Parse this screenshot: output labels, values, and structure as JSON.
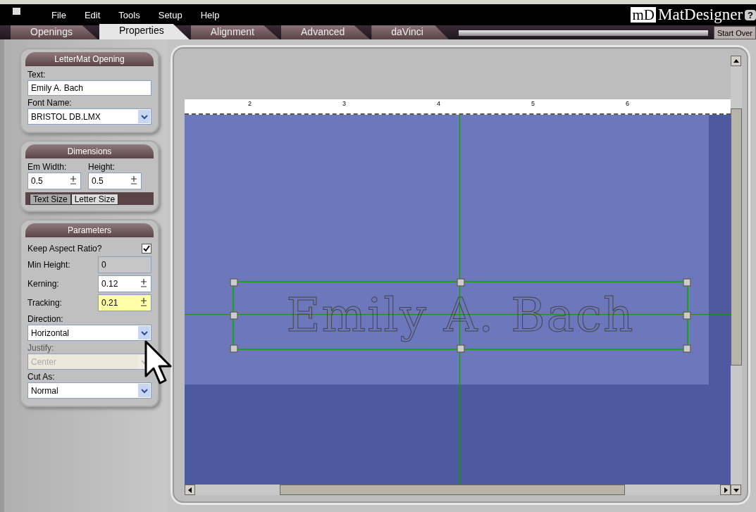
{
  "menu": [
    "File",
    "Edit",
    "Tools",
    "Setup",
    "Help"
  ],
  "brand": {
    "badge": "mD",
    "name": "MatDesigner",
    "help": "?"
  },
  "tabs": [
    {
      "label": "Openings",
      "selected": false
    },
    {
      "label": "Properties",
      "selected": true
    },
    {
      "label": "Alignment",
      "selected": false
    },
    {
      "label": "Advanced",
      "selected": false
    },
    {
      "label": "daVinci",
      "selected": false
    }
  ],
  "start_over": "Start Over",
  "lettermat": {
    "title": "LetterMat Opening",
    "text_label": "Text:",
    "text_value": "Emily A. Bach",
    "font_label": "Font Name:",
    "font_value": "BRISTOL DB.LMX"
  },
  "dimensions": {
    "title": "Dimensions",
    "width_label": "Em Width:",
    "width_value": "0.5",
    "height_label": "Height:",
    "height_value": "0.5",
    "subtabs": [
      {
        "label": "Text Size",
        "selected": false
      },
      {
        "label": "Letter Size",
        "selected": true
      }
    ]
  },
  "parameters": {
    "title": "Parameters",
    "keep_aspect_label": "Keep Aspect Ratio?",
    "keep_aspect_checked": true,
    "fields": [
      {
        "label": "Min Height:",
        "value": "0",
        "disabled": true,
        "focused": false
      },
      {
        "label": "Kerning:",
        "value": "0.12",
        "disabled": false,
        "focused": false
      },
      {
        "label": "Tracking:",
        "value": "0.21",
        "disabled": false,
        "focused": true
      }
    ],
    "selects": [
      {
        "label": "Direction:",
        "value": "Horizontal",
        "disabled": false
      },
      {
        "label": "Justify:",
        "value": "Center",
        "disabled": true
      },
      {
        "label": "Cut As:",
        "value": "Normal",
        "disabled": false
      }
    ]
  },
  "canvas": {
    "ruler": [
      "2",
      "3",
      "4",
      "5",
      "6"
    ],
    "text": "Emily A. Bach"
  }
}
